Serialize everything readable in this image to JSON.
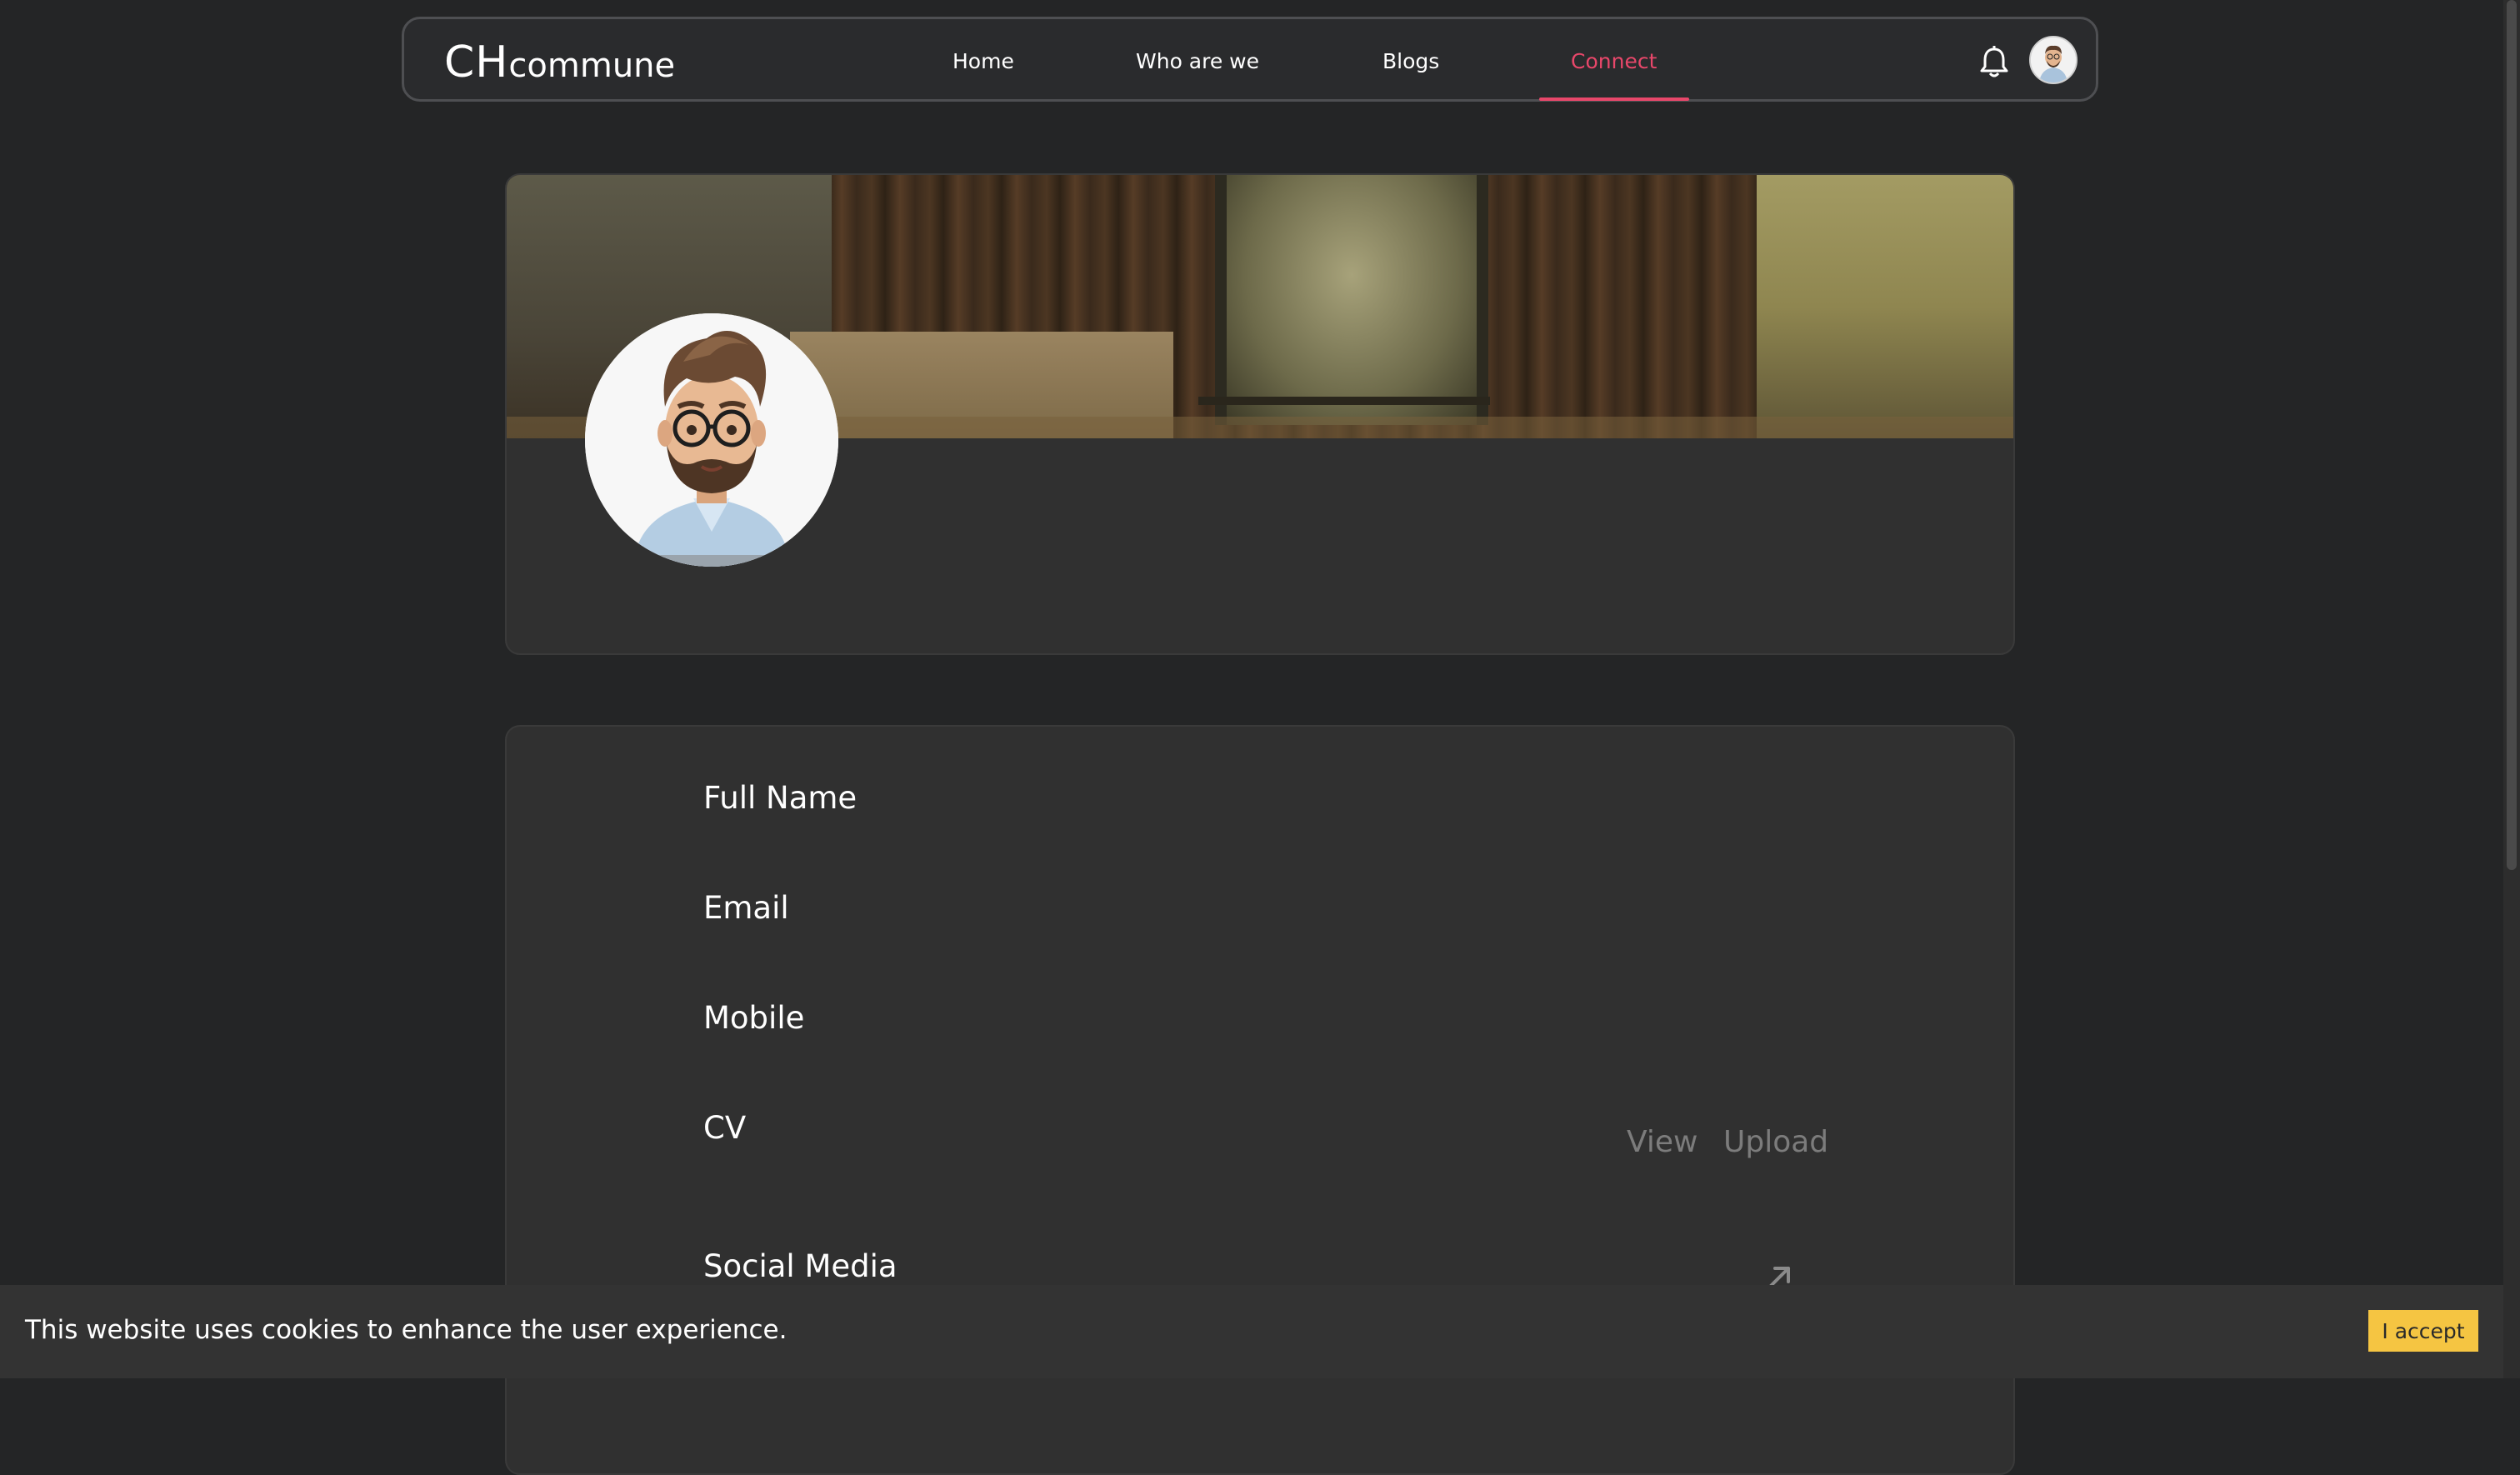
{
  "nav": {
    "logo_big": "CH",
    "logo_small": "commune",
    "items": [
      {
        "label": "Home"
      },
      {
        "label": "Who are we"
      },
      {
        "label": "Blogs"
      },
      {
        "label": "Connect"
      }
    ],
    "active_item": "Connect",
    "icons": {
      "notifications": "bell-icon",
      "user": "avatar"
    }
  },
  "profile": {
    "fields": {
      "full_name": "Full Name",
      "email": "Email",
      "mobile": "Mobile",
      "cv": "CV",
      "social_media": "Social Media"
    },
    "cv_actions": {
      "view": "View",
      "upload": "Upload"
    },
    "social_icon": "arrow-up-right-icon"
  },
  "cookie": {
    "message": "This website uses cookies to enhance the user experience.",
    "accept_label": "I accept"
  },
  "colors": {
    "accent": "#e8476a",
    "background": "#242526",
    "card": "#303030",
    "accept_button": "#f5c542"
  }
}
